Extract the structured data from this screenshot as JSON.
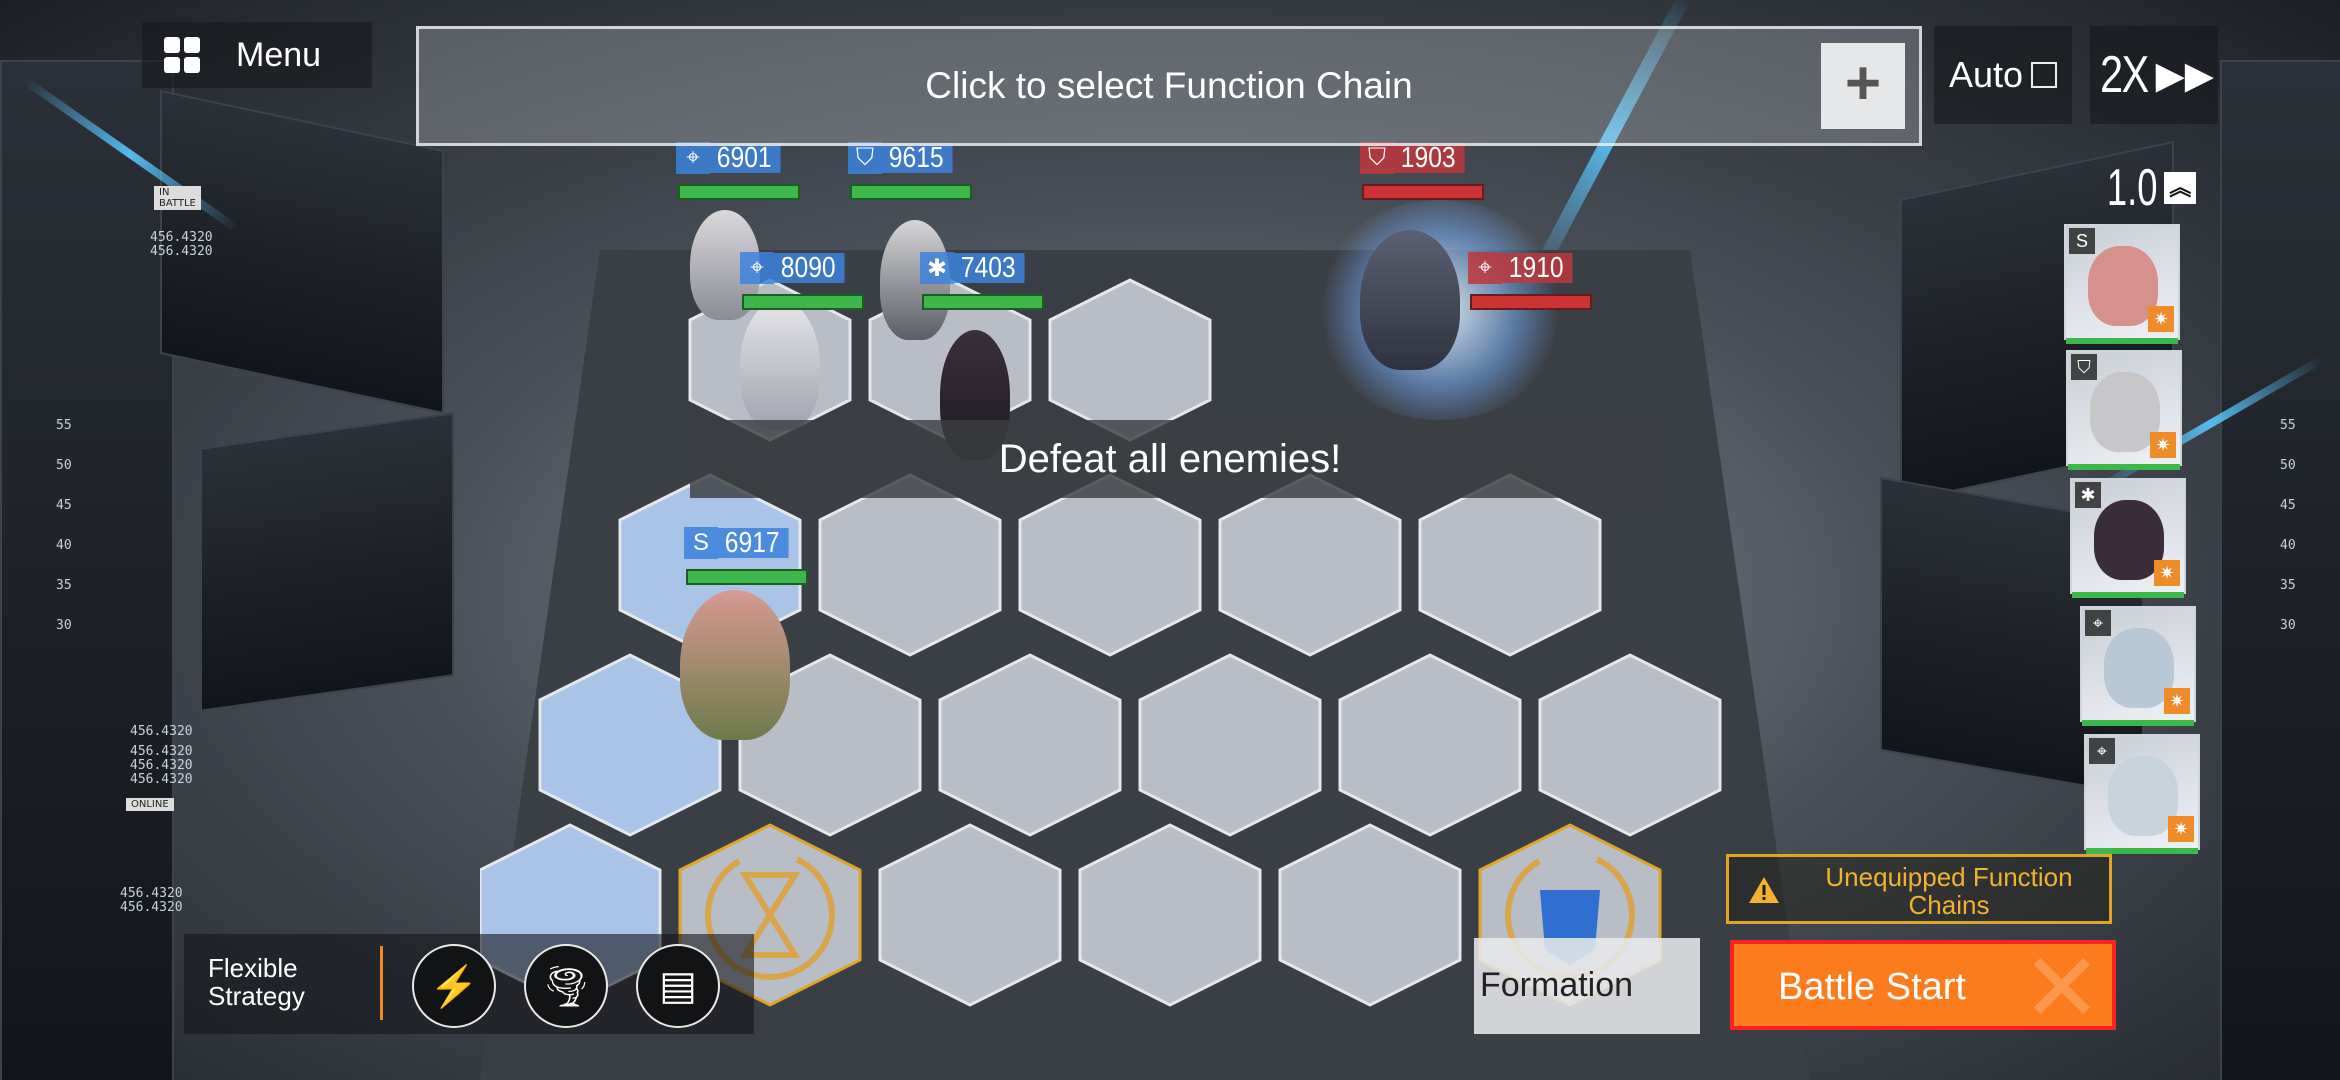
{
  "top_bar": {
    "menu_label": "Menu",
    "function_chain_prompt": "Click to select Function Chain",
    "add_function_chain": "+",
    "auto_label": "Auto",
    "speed_label": "2X",
    "speed_icon": "▶▶",
    "rate_label": "1.0",
    "rate_icon": "︽"
  },
  "side_readouts": {
    "in_battle": "IN BATTLE",
    "online": "ONLINE",
    "coord_a1": "456.4320",
    "coord_a2": "456.4320",
    "coord_b1": "456.4320",
    "coord_b2": "456.4320",
    "coord_b3": "456.4320",
    "coord_b4": "456.4320",
    "coord_c1": "456.4320",
    "coord_c2": "456.4320",
    "scale_left": [
      "55",
      "50",
      "45",
      "40",
      "35",
      "30"
    ],
    "scale_right": [
      "55",
      "50",
      "45",
      "40",
      "35",
      "30"
    ]
  },
  "units": {
    "ally_1": "6901",
    "ally_2": "9615",
    "ally_3": "8090",
    "ally_4": "7403",
    "ally_5": "6917",
    "enemy_1": "1903",
    "enemy_2": "1910"
  },
  "banner": {
    "text": "Defeat all enemies!"
  },
  "bottom_bar": {
    "strategy_label": "Flexible Strategy",
    "warning_text": "Unequipped Function Chains",
    "formation_label": "Formation",
    "battle_start_label": "Battle Start"
  },
  "colors": {
    "ally": "#3c82dc",
    "enemy": "#be373c",
    "accent_orange": "#fb7b1d",
    "warning_yellow": "#f3b12d"
  }
}
